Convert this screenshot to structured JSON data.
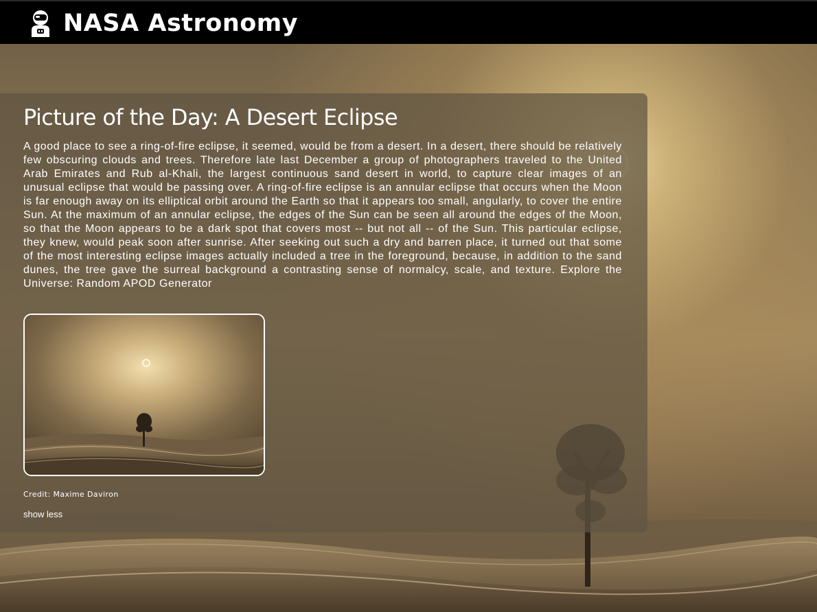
{
  "header": {
    "brand": "NASA Astronomy",
    "logo_icon": "astronaut-icon"
  },
  "apod": {
    "title": "Picture of the Day: A Desert Eclipse",
    "explanation": "A good place to see a ring-of-fire eclipse, it seemed, would be from a desert. In a desert, there should be relatively few obscuring clouds and trees. Therefore late last December a group of photographers traveled to the United Arab Emirates and Rub al-Khali, the largest continuous sand desert in world, to capture clear images of an unusual eclipse that would be passing over. A ring-of-fire eclipse is an annular eclipse that occurs when the Moon is far enough away on its elliptical orbit around the Earth so that it appears too small, angularly, to cover the entire Sun. At the maximum of an annular eclipse, the edges of the Sun can be seen all around the edges of the Moon, so that the Moon appears to be a dark spot that covers most -- but not all -- of the Sun. This particular eclipse, they knew, would peak soon after sunrise. After seeking out such a dry and barren place, it turned out that some of the most interesting eclipse images actually included a tree in the foreground, because, in addition to the sand dunes, the tree gave the surreal background a contrasting sense of normalcy, scale, and texture. Explore the Universe: Random APOD Generator",
    "credit": "Credit: Maxime Daviron",
    "toggle_label": "show less"
  }
}
